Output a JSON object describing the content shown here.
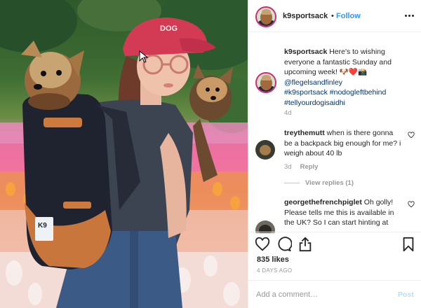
{
  "post": {
    "username": "k9sportsack",
    "dot": "•",
    "follow_label": "Follow",
    "more_icon": "more-horizontal-icon"
  },
  "photo": {
    "cap_text": "DOG",
    "patch_text": "K9"
  },
  "caption": {
    "username": "k9sportsack",
    "text": " Here's to wishing everyone a fantastic Sunday and upcoming week! 🐶❤️📸 ",
    "mention": "@flegelsandfinley",
    "hashtags": "#k9sportsack #nodogleftbehind #tellyourdogisaidhi",
    "time": "4d"
  },
  "comments": [
    {
      "username": "treythemutt",
      "text": " when is there gonna be a backpack big enough for me? i weigh about 40 lb",
      "time": "3d",
      "reply_label": "Reply",
      "view_replies": "View replies (1)"
    },
    {
      "username": "georgethefrenchpiglet",
      "text": " Oh golly! Please tells me this is available in the UK? So I can start hinting at"
    }
  ],
  "actions": {
    "likes": "835 likes",
    "time_ago": "4 DAYS AGO"
  },
  "add_comment": {
    "placeholder": "Add a comment…",
    "post_label": "Post"
  },
  "colors": {
    "link_blue": "#3897f0",
    "hashtag": "#003569",
    "muted": "#999999",
    "post_disabled": "#b2dffc"
  }
}
